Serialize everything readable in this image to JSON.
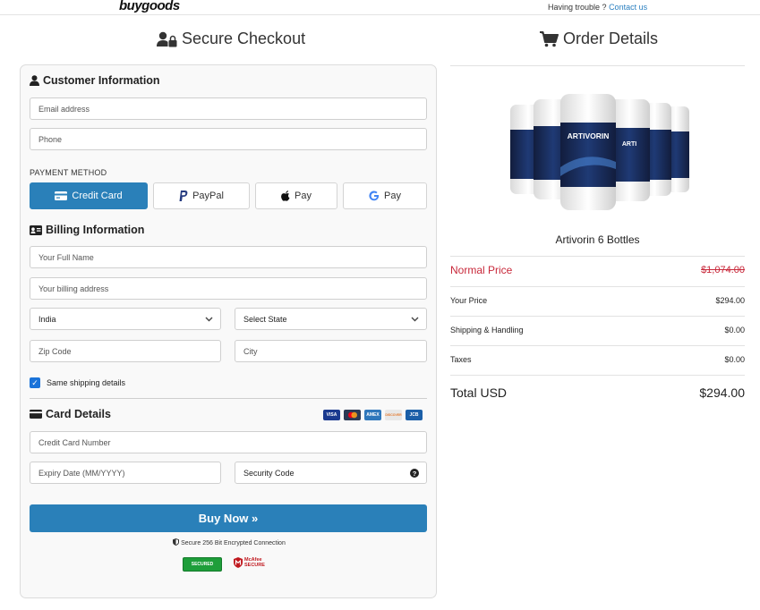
{
  "topbar": {
    "logo": "buygoods",
    "help_text": "Having trouble ?",
    "help_link": "Contact us"
  },
  "left": {
    "title": "Secure Checkout",
    "customer": {
      "title": "Customer Information",
      "email_placeholder": "Email address",
      "phone_placeholder": "Phone"
    },
    "payment": {
      "label": "PAYMENT METHOD",
      "methods": [
        "Credit Card",
        "PayPal",
        "Pay",
        "Pay"
      ],
      "active": "Credit Card"
    },
    "billing": {
      "title": "Billing Information",
      "name_placeholder": "Your Full Name",
      "address_placeholder": "Your billing address",
      "country_value": "India",
      "state_value": "Select State",
      "zip_placeholder": "Zip Code",
      "city_placeholder": "City",
      "same_shipping_label": "Same shipping details",
      "same_shipping_checked": true
    },
    "card": {
      "title": "Card Details",
      "brands": [
        "VISA",
        "MC",
        "AMEX",
        "DISCOVER",
        "JCB"
      ],
      "number_placeholder": "Credit Card Number",
      "expiry_placeholder": "Expiry Date (MM/YYYY)",
      "cvv_placeholder": "Security Code"
    },
    "buy_label": "Buy Now »",
    "secure_text": "Secure 256 Bit Encrypted Connection",
    "badges": {
      "secured": "SECURED",
      "mcafee_line1": "McAfee",
      "mcafee_line2": "SECURE"
    }
  },
  "right": {
    "title": "Order Details",
    "product_name": "Artivorin 6 Bottles",
    "bottle_label": "ARTIVORIN",
    "normal_price_label": "Normal Price",
    "normal_price_value": "$1,074.00",
    "rows": [
      {
        "label": "Your Price",
        "value": "$294.00"
      },
      {
        "label": "Shipping & Handling",
        "value": "$0.00"
      },
      {
        "label": "Taxes",
        "value": "$0.00"
      }
    ],
    "total_label": "Total USD",
    "total_value": "$294.00"
  },
  "colors": {
    "accent": "#2a80b9",
    "normal_price": "#c8283a",
    "link": "#2a7fc0"
  }
}
